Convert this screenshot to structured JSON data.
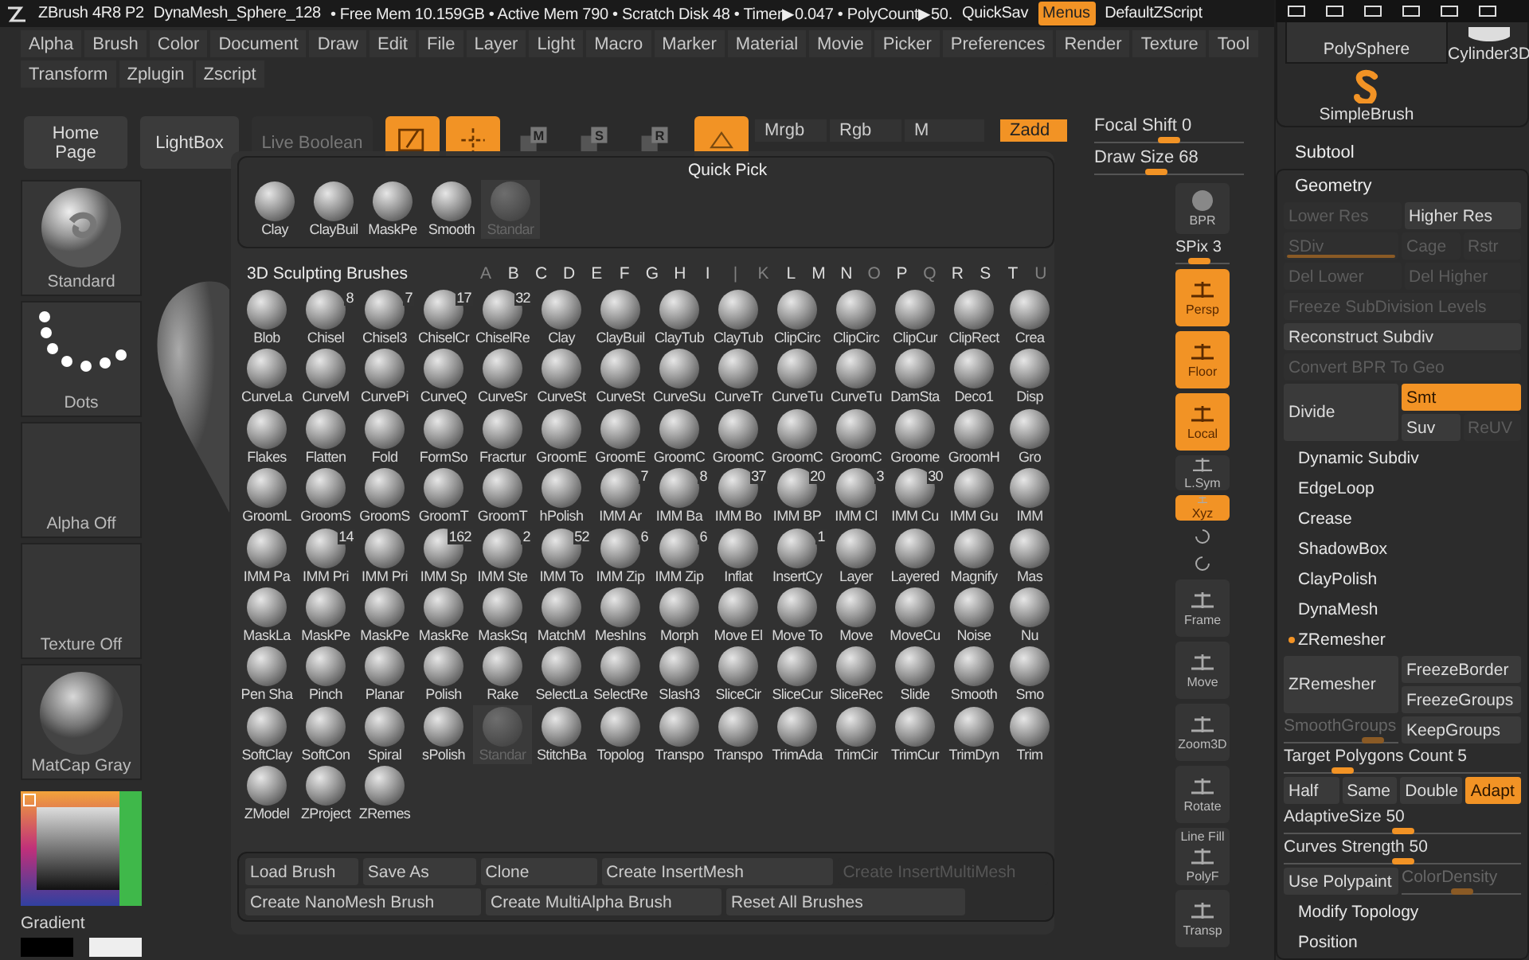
{
  "title_bar": {
    "app": "ZBrush 4R8 P2",
    "document": "DynaMesh_Sphere_128",
    "stats": "• Free Mem 10.159GB • Active Mem 790 • Scratch Disk 48 • Timer▶0.047 • PolyCount▶50.",
    "quicksave": "QuickSav",
    "menus": {
      "label": "Menus",
      "on": true
    },
    "script": "DefaultZScript"
  },
  "menu_rows": [
    [
      "Alpha",
      "Brush",
      "Color",
      "Document",
      "Draw",
      "Edit",
      "File",
      "Layer",
      "Light",
      "Macro",
      "Marker",
      "Material",
      "Movie",
      "Picker",
      "Preferences",
      "Render",
      "Texture",
      "Tool"
    ],
    [
      "Transform",
      "Zplugin",
      "Zscript"
    ]
  ],
  "toolbar": {
    "buttons": [
      {
        "label": "Home Page",
        "disabled": false
      },
      {
        "label": "LightBox",
        "disabled": false
      },
      {
        "label": "Live Boolean",
        "disabled": true
      }
    ],
    "tools": [
      {
        "kind": "edit",
        "on": true
      },
      {
        "kind": "draw",
        "on": true
      },
      {
        "kind": "move",
        "on": false,
        "letter": "M"
      },
      {
        "kind": "scale",
        "on": false,
        "letter": "S"
      },
      {
        "kind": "rotate",
        "on": false,
        "letter": "R"
      },
      {
        "kind": "sculptris",
        "on": true
      }
    ],
    "channels": [
      {
        "label": "Mrgb",
        "on": false
      },
      {
        "label": "Rgb",
        "on": false
      },
      {
        "label": "M",
        "on": false
      },
      {
        "label": "Zadd",
        "on": true
      }
    ],
    "focal_shift": {
      "label": "Focal Shift",
      "value": "0",
      "level": 0.5
    },
    "draw_size": {
      "label": "Draw Size",
      "value": "68",
      "level": 0.4
    }
  },
  "shelf": [
    {
      "label": "Standard",
      "kind": "brush"
    },
    {
      "label": "Dots",
      "kind": "stroke"
    },
    {
      "label": "Alpha Off",
      "kind": "empty"
    },
    {
      "label": "Texture Off",
      "kind": "empty"
    },
    {
      "label": "MatCap Gray",
      "kind": "material"
    }
  ],
  "color_picker": {
    "label": "Gradient",
    "swatches": [
      {
        "color": "#000000"
      },
      {
        "color": "#eeeeee"
      }
    ]
  },
  "quick_pick": {
    "title": "Quick Pick",
    "items": [
      {
        "name": "Clay",
        "selected": false
      },
      {
        "name": "ClayBuil",
        "selected": false
      },
      {
        "name": "MaskPe",
        "selected": false
      },
      {
        "name": "Smooth",
        "selected": false
      },
      {
        "name": "Standar",
        "selected": true
      }
    ]
  },
  "brushes": {
    "title": "3D Sculpting Brushes",
    "letters": [
      {
        "letter": "A",
        "available": false
      },
      {
        "letter": "B",
        "available": true
      },
      {
        "letter": "C",
        "available": true
      },
      {
        "letter": "D",
        "available": true
      },
      {
        "letter": "E",
        "available": true
      },
      {
        "letter": "F",
        "available": true
      },
      {
        "letter": "G",
        "available": true
      },
      {
        "letter": "H",
        "available": true
      },
      {
        "letter": "I",
        "available": true
      },
      {
        "letter": "|",
        "available": false
      },
      {
        "letter": "K",
        "available": false
      },
      {
        "letter": "L",
        "available": true
      },
      {
        "letter": "M",
        "available": true
      },
      {
        "letter": "N",
        "available": true
      },
      {
        "letter": "O",
        "available": false
      },
      {
        "letter": "P",
        "available": true
      },
      {
        "letter": "Q",
        "available": false
      },
      {
        "letter": "R",
        "available": true
      },
      {
        "letter": "S",
        "available": true
      },
      {
        "letter": "T",
        "available": true
      },
      {
        "letter": "U",
        "available": false
      }
    ],
    "items": [
      {
        "name": "Blob",
        "selected": false
      },
      {
        "name": "Chisel",
        "selected": false,
        "count": "8"
      },
      {
        "name": "Chisel3",
        "selected": false,
        "count": "7"
      },
      {
        "name": "ChiselCr",
        "selected": false,
        "count": "17"
      },
      {
        "name": "ChiselRe",
        "selected": false,
        "count": "32"
      },
      {
        "name": "Clay",
        "selected": false
      },
      {
        "name": "ClayBuil",
        "selected": false
      },
      {
        "name": "ClayTub",
        "selected": false
      },
      {
        "name": "ClayTub",
        "selected": false
      },
      {
        "name": "ClipCirc",
        "selected": false
      },
      {
        "name": "ClipCirc",
        "selected": false
      },
      {
        "name": "ClipCur",
        "selected": false
      },
      {
        "name": "ClipRect",
        "selected": false
      },
      {
        "name": "Crea",
        "selected": false
      },
      {
        "name": "CurveLa",
        "selected": false
      },
      {
        "name": "CurveM",
        "selected": false
      },
      {
        "name": "CurvePi",
        "selected": false
      },
      {
        "name": "CurveQ",
        "selected": false
      },
      {
        "name": "CurveSr",
        "selected": false
      },
      {
        "name": "CurveSt",
        "selected": false
      },
      {
        "name": "CurveSt",
        "selected": false
      },
      {
        "name": "CurveSu",
        "selected": false
      },
      {
        "name": "CurveTr",
        "selected": false
      },
      {
        "name": "CurveTu",
        "selected": false
      },
      {
        "name": "CurveTu",
        "selected": false
      },
      {
        "name": "DamSta",
        "selected": false
      },
      {
        "name": "Deco1",
        "selected": false
      },
      {
        "name": "Disp",
        "selected": false
      },
      {
        "name": "Flakes",
        "selected": false
      },
      {
        "name": "Flatten",
        "selected": false
      },
      {
        "name": "Fold",
        "selected": false
      },
      {
        "name": "FormSo",
        "selected": false
      },
      {
        "name": "Fracrtur",
        "selected": false
      },
      {
        "name": "GroomE",
        "selected": false
      },
      {
        "name": "GroomE",
        "selected": false
      },
      {
        "name": "GroomC",
        "selected": false
      },
      {
        "name": "GroomC",
        "selected": false
      },
      {
        "name": "GroomC",
        "selected": false
      },
      {
        "name": "GroomC",
        "selected": false
      },
      {
        "name": "Groome",
        "selected": false
      },
      {
        "name": "GroomH",
        "selected": false
      },
      {
        "name": "Gro",
        "selected": false
      },
      {
        "name": "GroomL",
        "selected": false
      },
      {
        "name": "GroomS",
        "selected": false
      },
      {
        "name": "GroomS",
        "selected": false
      },
      {
        "name": "GroomT",
        "selected": false
      },
      {
        "name": "GroomT",
        "selected": false
      },
      {
        "name": "hPolish",
        "selected": false
      },
      {
        "name": "IMM Ar",
        "selected": false,
        "count": "7"
      },
      {
        "name": "IMM Ba",
        "selected": false,
        "count": "8"
      },
      {
        "name": "IMM Bo",
        "selected": false,
        "count": "37"
      },
      {
        "name": "IMM BP",
        "selected": false,
        "count": "20"
      },
      {
        "name": "IMM Cl",
        "selected": false,
        "count": "3"
      },
      {
        "name": "IMM Cu",
        "selected": false,
        "count": "30"
      },
      {
        "name": "IMM Gu",
        "selected": false
      },
      {
        "name": "IMM",
        "selected": false
      },
      {
        "name": "IMM Pa",
        "selected": false
      },
      {
        "name": "IMM Pri",
        "selected": false,
        "count": "14"
      },
      {
        "name": "IMM Pri",
        "selected": false
      },
      {
        "name": "IMM Sp",
        "selected": false,
        "count": "162"
      },
      {
        "name": "IMM Ste",
        "selected": false,
        "count": "2"
      },
      {
        "name": "IMM To",
        "selected": false,
        "count": "52"
      },
      {
        "name": "IMM Zip",
        "selected": false,
        "count": "6"
      },
      {
        "name": "IMM Zip",
        "selected": false,
        "count": "6"
      },
      {
        "name": "Inflat",
        "selected": false
      },
      {
        "name": "InsertCy",
        "selected": false,
        "count": "1"
      },
      {
        "name": "Layer",
        "selected": false
      },
      {
        "name": "Layered",
        "selected": false
      },
      {
        "name": "Magnify",
        "selected": false
      },
      {
        "name": "Mas",
        "selected": false
      },
      {
        "name": "MaskLa",
        "selected": false
      },
      {
        "name": "MaskPe",
        "selected": false
      },
      {
        "name": "MaskPe",
        "selected": false
      },
      {
        "name": "MaskRe",
        "selected": false
      },
      {
        "name": "MaskSq",
        "selected": false
      },
      {
        "name": "MatchM",
        "selected": false
      },
      {
        "name": "MeshIns",
        "selected": false
      },
      {
        "name": "Morph",
        "selected": false
      },
      {
        "name": "Move El",
        "selected": false
      },
      {
        "name": "Move To",
        "selected": false
      },
      {
        "name": "Move",
        "selected": false
      },
      {
        "name": "MoveCu",
        "selected": false
      },
      {
        "name": "Noise",
        "selected": false
      },
      {
        "name": "Nu",
        "selected": false
      },
      {
        "name": "Pen Sha",
        "selected": false
      },
      {
        "name": "Pinch",
        "selected": false
      },
      {
        "name": "Planar",
        "selected": false
      },
      {
        "name": "Polish",
        "selected": false
      },
      {
        "name": "Rake",
        "selected": false
      },
      {
        "name": "SelectLa",
        "selected": false
      },
      {
        "name": "SelectRe",
        "selected": false
      },
      {
        "name": "Slash3",
        "selected": false
      },
      {
        "name": "SliceCir",
        "selected": false
      },
      {
        "name": "SliceCur",
        "selected": false
      },
      {
        "name": "SliceRec",
        "selected": false
      },
      {
        "name": "Slide",
        "selected": false
      },
      {
        "name": "Smooth",
        "selected": false
      },
      {
        "name": "Smo",
        "selected": false
      },
      {
        "name": "SoftClay",
        "selected": false
      },
      {
        "name": "SoftCon",
        "selected": false
      },
      {
        "name": "Spiral",
        "selected": false
      },
      {
        "name": "sPolish",
        "selected": false
      },
      {
        "name": "Standar",
        "selected": true
      },
      {
        "name": "StitchBa",
        "selected": false
      },
      {
        "name": "Topolog",
        "selected": false
      },
      {
        "name": "Transpo",
        "selected": false
      },
      {
        "name": "Transpo",
        "selected": false
      },
      {
        "name": "TrimAda",
        "selected": false
      },
      {
        "name": "TrimCir",
        "selected": false
      },
      {
        "name": "TrimCur",
        "selected": false
      },
      {
        "name": "TrimDyn",
        "selected": false
      },
      {
        "name": "Trim",
        "selected": false
      },
      {
        "name": "ZModel",
        "selected": false
      },
      {
        "name": "ZProject",
        "selected": false
      },
      {
        "name": "ZRemes",
        "selected": false
      }
    ]
  },
  "brush_actions": [
    {
      "label": "Load Brush",
      "disabled": false
    },
    {
      "label": "Save As",
      "disabled": false
    },
    {
      "label": "Clone",
      "disabled": false
    },
    {
      "label": "Create InsertMesh",
      "disabled": false
    },
    {
      "label": "Create InsertMultiMesh",
      "disabled": true
    },
    {
      "label": "Create NanoMesh Brush",
      "disabled": false
    },
    {
      "label": "Create MultiAlpha Brush",
      "disabled": false
    },
    {
      "label": "Reset All Brushes",
      "disabled": false
    }
  ],
  "viewport_tools": [
    {
      "label": "BPR",
      "on": false
    },
    {
      "label": "Persp",
      "on": true
    },
    {
      "label": "Floor",
      "on": true
    },
    {
      "label": "Local",
      "on": true
    },
    {
      "label": "L.Sym",
      "on": false
    },
    {
      "label": "Xyz",
      "on": true
    },
    {
      "label": "Frame",
      "on": false
    },
    {
      "label": "Move",
      "on": false
    },
    {
      "label": "Zoom3D",
      "on": false
    },
    {
      "label": "Rotate",
      "on": false
    },
    {
      "label": "PolyF",
      "on": false,
      "caption": "Line Fill"
    },
    {
      "label": "Transp",
      "on": false
    }
  ],
  "spix": {
    "label": "SPix",
    "value": "3",
    "level": 0.4
  },
  "tool_thumbs": [
    {
      "label": "PolySphere",
      "kind": "button"
    },
    {
      "label": "Cylinder3D",
      "kind": "cylinder"
    },
    {
      "label": "SimpleBrush",
      "kind": "logo"
    }
  ],
  "subtool": "Subtool",
  "geometry": {
    "title": "Geometry",
    "lower_res": {
      "label": "Lower Res",
      "disabled": true
    },
    "higher_res": {
      "label": "Higher Res",
      "disabled": false
    },
    "sdiv": {
      "label": "SDiv",
      "disabled": true,
      "level": 1
    },
    "cage": {
      "label": "Cage",
      "disabled": true
    },
    "rstr": {
      "label": "Rstr",
      "disabled": true
    },
    "del_lower": {
      "label": "Del Lower",
      "disabled": true
    },
    "del_higher": {
      "label": "Del Higher",
      "disabled": true
    },
    "freeze_levels": {
      "label": "Freeze SubDivision Levels",
      "disabled": true
    },
    "reconstruct": {
      "label": "Reconstruct Subdiv",
      "disabled": false
    },
    "convert_bpr": {
      "label": "Convert BPR To Geo",
      "disabled": true
    },
    "divide": {
      "label": "Divide",
      "disabled": false
    },
    "smt": {
      "label": "Smt",
      "on": true
    },
    "suv": {
      "label": "Suv",
      "on": false
    },
    "reuv": {
      "label": "ReUV",
      "disabled": true
    },
    "sections": [
      {
        "label": "Dynamic Subdiv",
        "expanded": false
      },
      {
        "label": "EdgeLoop",
        "expanded": false
      },
      {
        "label": "Crease",
        "expanded": false
      },
      {
        "label": "ShadowBox",
        "expanded": false
      },
      {
        "label": "ClayPolish",
        "expanded": false
      },
      {
        "label": "DynaMesh",
        "expanded": false
      }
    ],
    "zremesher": {
      "title": "ZRemesher",
      "expanded": true,
      "button": {
        "label": "ZRemesher",
        "disabled": false
      },
      "freeze_border": {
        "label": "FreezeBorder",
        "on": false
      },
      "freeze_groups": {
        "label": "FreezeGroups",
        "on": false
      },
      "smooth_groups": {
        "label": "SmoothGroups",
        "disabled": true,
        "level": 0.85
      },
      "keep_groups": {
        "label": "KeepGroups",
        "on": false
      },
      "target": {
        "label": "Target Polygons Count",
        "value": "5",
        "level": 0.22
      },
      "modes": [
        {
          "label": "Half",
          "selected": false
        },
        {
          "label": "Same",
          "selected": false
        },
        {
          "label": "Double",
          "selected": false
        },
        {
          "label": "Adapt",
          "selected": true
        }
      ],
      "adaptive_size": {
        "label": "AdaptiveSize",
        "value": "50",
        "level": 0.5
      },
      "curves_strength": {
        "label": "Curves Strength",
        "value": "50",
        "level": 0.5
      },
      "use_polypaint": {
        "label": "Use Polypaint",
        "on": false
      },
      "color_density": {
        "label": "ColorDensity",
        "disabled": true,
        "level": 0.5
      }
    },
    "more_sections": [
      {
        "label": "Modify Topology",
        "expanded": false
      },
      {
        "label": "Position",
        "expanded": false
      }
    ]
  }
}
